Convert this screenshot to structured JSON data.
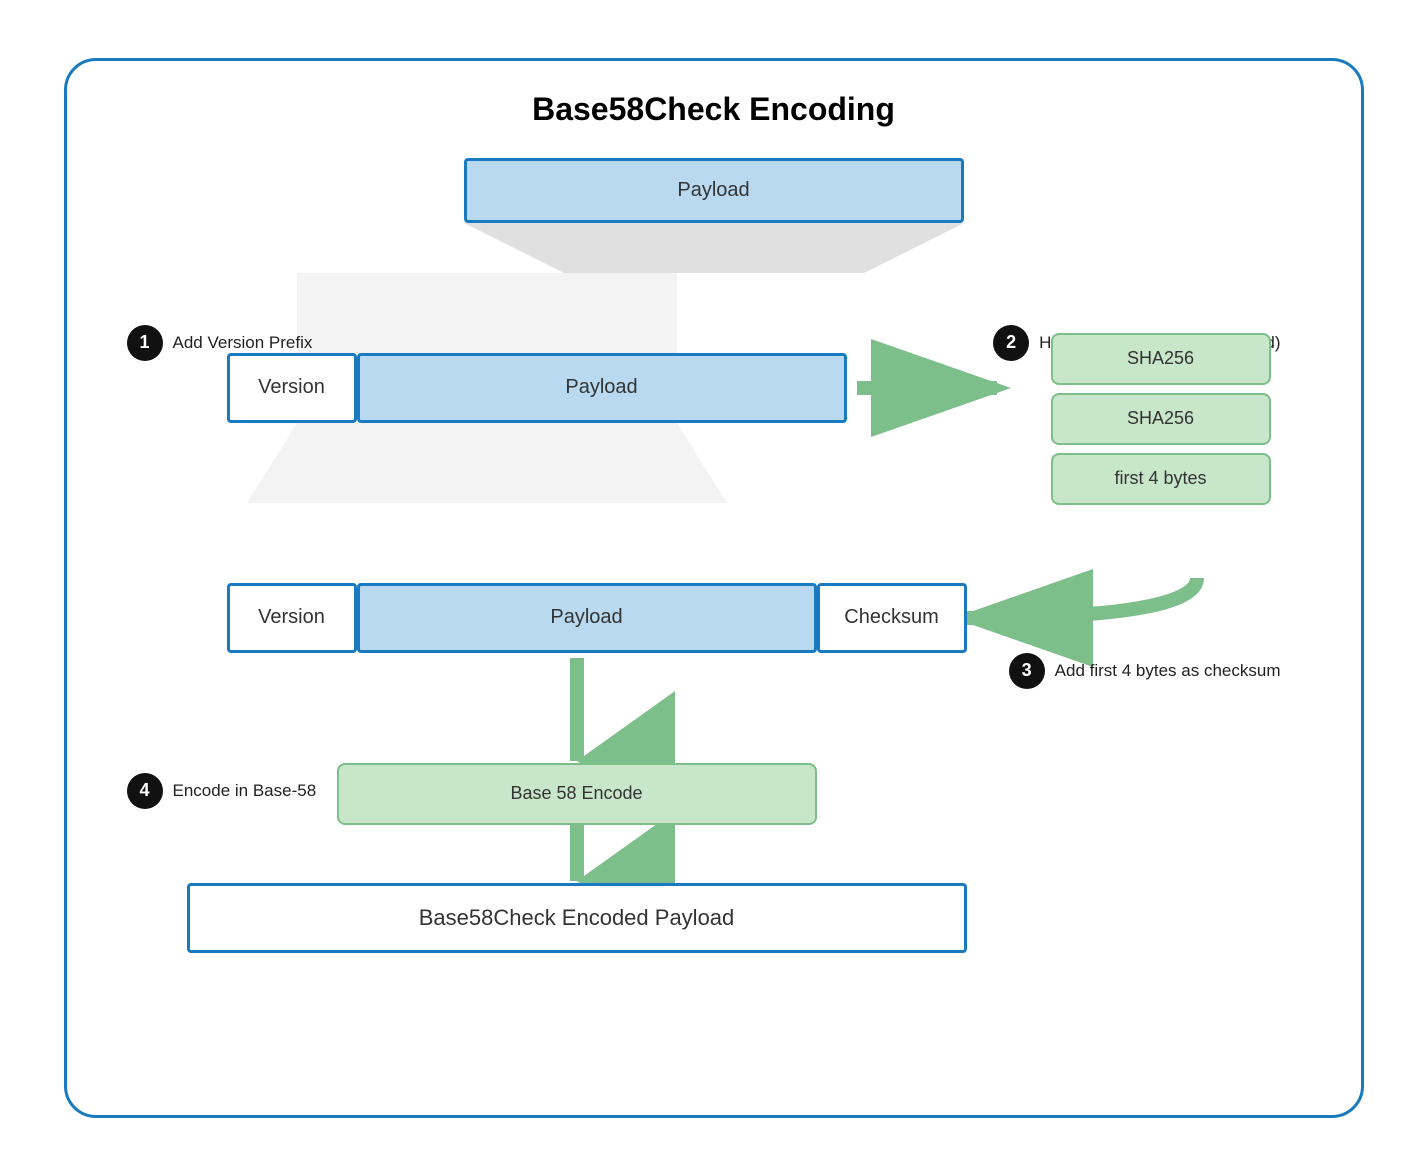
{
  "title": "Base58Check Encoding",
  "steps": [
    {
      "number": "1",
      "label": "Add Version Prefix"
    },
    {
      "number": "2",
      "label": "Hash (Version Prefix + Payload)"
    },
    {
      "number": "3",
      "label": "Add first 4 bytes as checksum"
    },
    {
      "number": "4",
      "label": "Encode in Base-58"
    }
  ],
  "boxes": {
    "payload_top": "Payload",
    "version1": "Version",
    "payload_r1": "Payload",
    "sha1": "SHA256",
    "sha2": "SHA256",
    "first4": "first 4 bytes",
    "version2": "Version",
    "payload_r2": "Payload",
    "checksum": "Checksum",
    "base58encode": "Base 58 Encode",
    "final": "Base58Check Encoded Payload"
  },
  "colors": {
    "blue_border": "#1a7abf",
    "blue_fill": "#b8d9f0",
    "green_border": "#7dbf8a",
    "green_fill": "#c8e6c9",
    "arrow_green": "#7dbf8a",
    "funnel_gray": "#e0e0e0",
    "container_border": "#1a7abf",
    "circle_bg": "#111111"
  }
}
